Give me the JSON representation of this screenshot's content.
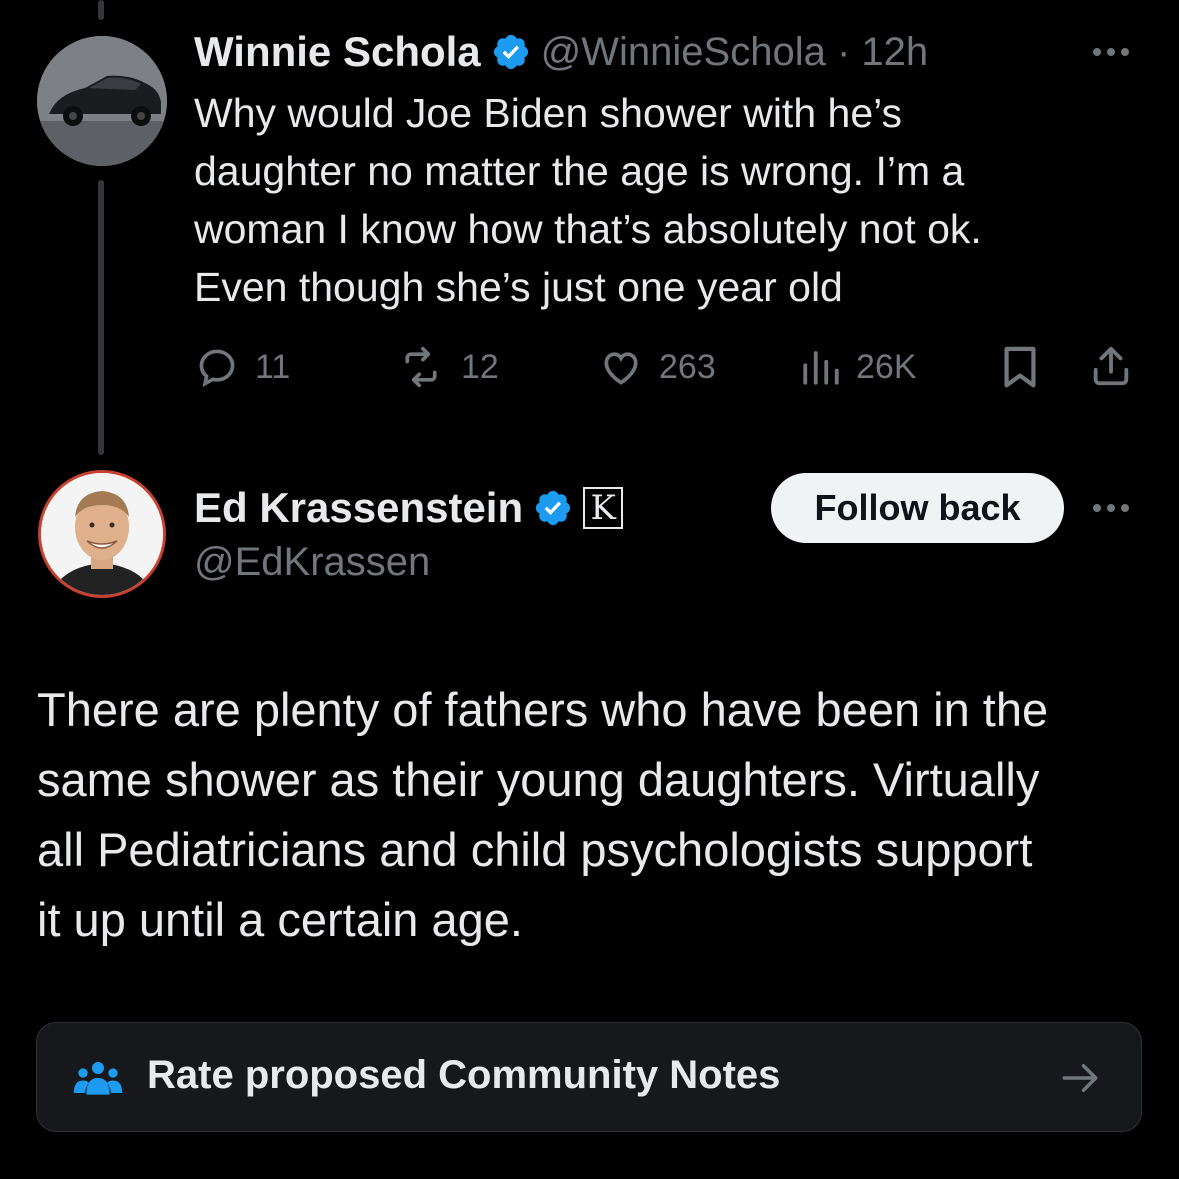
{
  "tweet1": {
    "display_name": "Winnie Schola",
    "handle_time": "@WinnieSchola · 12h",
    "text_lines": [
      "Why would Joe Biden shower with he’s",
      "daughter no matter the age is wrong. I’m a",
      "woman I know how that’s absolutely not ok.",
      "Even though she’s just one year old"
    ],
    "replies": "11",
    "reposts": "12",
    "likes": "263",
    "views": "26K"
  },
  "tweet2": {
    "display_name": "Ed Krassenstein",
    "handle": "@EdKrassen",
    "badge_letter": "K",
    "follow_button": "Follow back",
    "text_lines": [
      "There are plenty of fathers who have been in the",
      "same shower as their young daughters.  Virtually",
      "all Pediatricians and child psychologists support",
      "it up until a certain age."
    ]
  },
  "community_notes": {
    "label": "Rate proposed Community Notes"
  },
  "colors": {
    "background": "#000000",
    "text": "#e7e9ea",
    "muted": "#71767b",
    "verified": "#1d9bf0"
  },
  "icons": [
    "reply-icon",
    "repost-icon",
    "like-icon",
    "views-icon",
    "bookmark-icon",
    "share-icon",
    "verified-badge-icon",
    "more-icon",
    "people-icon",
    "arrow-right-icon"
  ]
}
